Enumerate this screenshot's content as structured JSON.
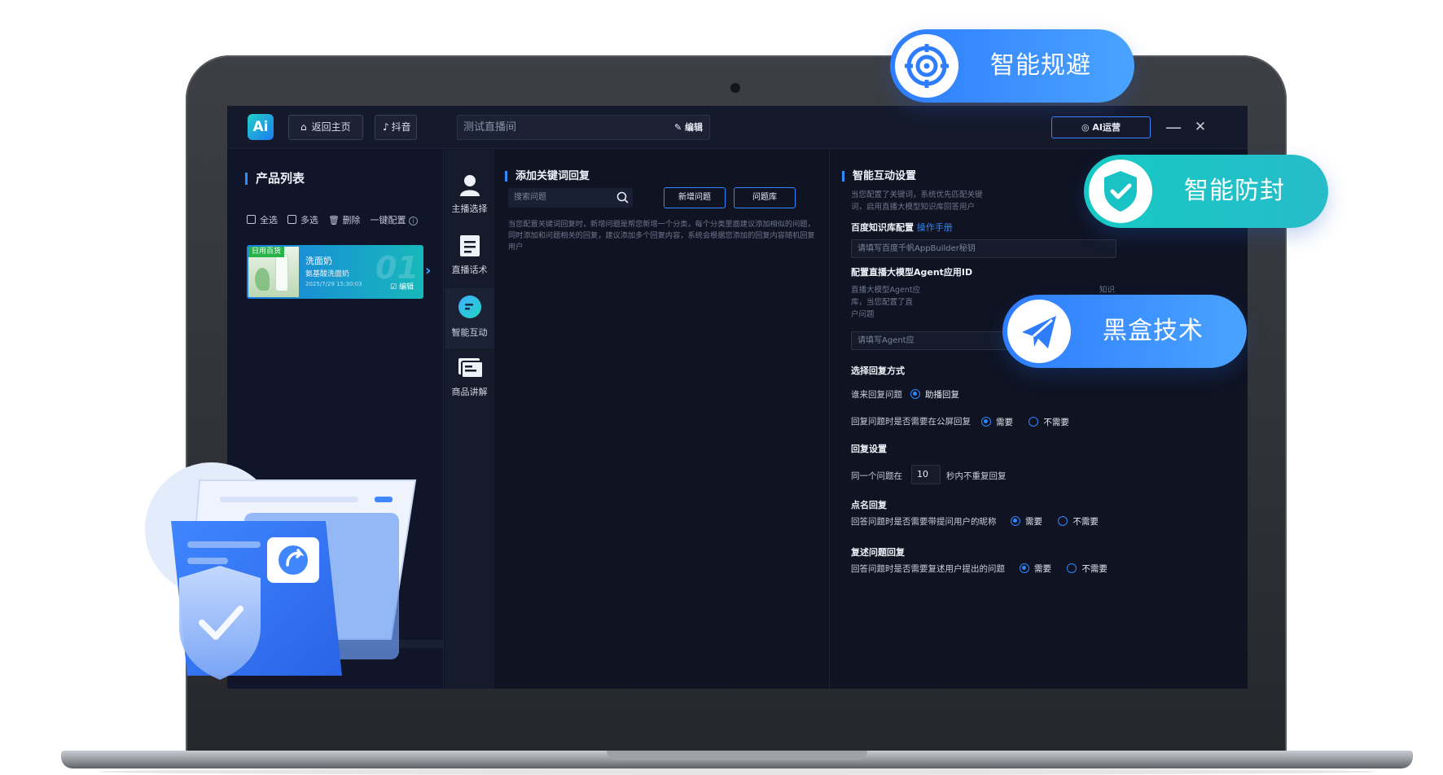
{
  "titlebar": {
    "logo": "Ai",
    "home_label": "返回主页",
    "platform_label": "抖音",
    "room_name": "测试直播间",
    "edit_label": "编辑",
    "ai_ops_label": "AI运营",
    "minimize": "—",
    "close": "✕"
  },
  "left_panel": {
    "title": "产品列表",
    "select_all": "全选",
    "multi_select": "多选",
    "delete": "删除",
    "one_click_config": "一键配置",
    "product": {
      "tag": "日用百货",
      "name": "洗面奶",
      "desc": "氨基酸洗面奶",
      "date": "2025/7/29 15:30:03",
      "number": "01",
      "edit": "编辑"
    }
  },
  "nav": {
    "items": [
      {
        "label": "主播选择",
        "icon": "person-icon"
      },
      {
        "label": "直播话术",
        "icon": "script-icon"
      },
      {
        "label": "智能互动",
        "icon": "chat-icon"
      },
      {
        "label": "商品讲解",
        "icon": "product-icon"
      }
    ]
  },
  "middle_panel": {
    "title": "添加关键词回复",
    "search_placeholder": "搜索问题",
    "new_question": "新增问题",
    "question_bank": "问题库",
    "description": "当您配置关键词回复时，新增问题是帮您新增一个分类，每个分类里面建议添加相似的问题，同时添加和问题相关的回复，建议添加多个回复内容，系统会根据您添加的回复内容随机回复用户"
  },
  "right_panel": {
    "title": "智能互动设置",
    "intro": "当您配置了关键词，系统优先匹配关键词，启用直播大模型知识库回答用户",
    "baidu_kb_label": "百度知识库配置",
    "manual_link": "操作手册",
    "appbuilder_placeholder": "请填写百度千帆AppBuilder秘钥",
    "agent_label": "配置直播大模型Agent应用ID",
    "agent_desc_line1": "直播大模型Agent应",
    "agent_desc_line1_end": "知识",
    "agent_desc_line2": "库，当您配置了直",
    "agent_desc_line3": "户问题",
    "agent_placeholder": "请填写Agent应",
    "reply_mode_head": "选择回复方式",
    "who_replies_label": "谁来回复问题",
    "who_replies_option": "助播回复",
    "public_screen_label": "回复问题时是否需要在公屏回复",
    "need": "需要",
    "not_need": "不需要",
    "reply_settings_head": "回复设置",
    "same_question_prefix": "同一个问题在",
    "same_question_seconds": "10",
    "same_question_suffix": "秒内不重复回复",
    "mention_head": "点名回复",
    "mention_label": "回答问题时是否需要带提问用户的昵称",
    "repeat_head": "复述问题回复",
    "repeat_label": "回答问题时是否需要复述用户提出的问题"
  },
  "badges": {
    "avoid": "智能规避",
    "anti_ban": "智能防封",
    "blackbox": "黑盒技术"
  },
  "colors": {
    "accent": "#2f86ff",
    "badge_blue": "#3a8cff",
    "badge_teal": "#19c4c6",
    "panel_bg": "#0f1322"
  }
}
